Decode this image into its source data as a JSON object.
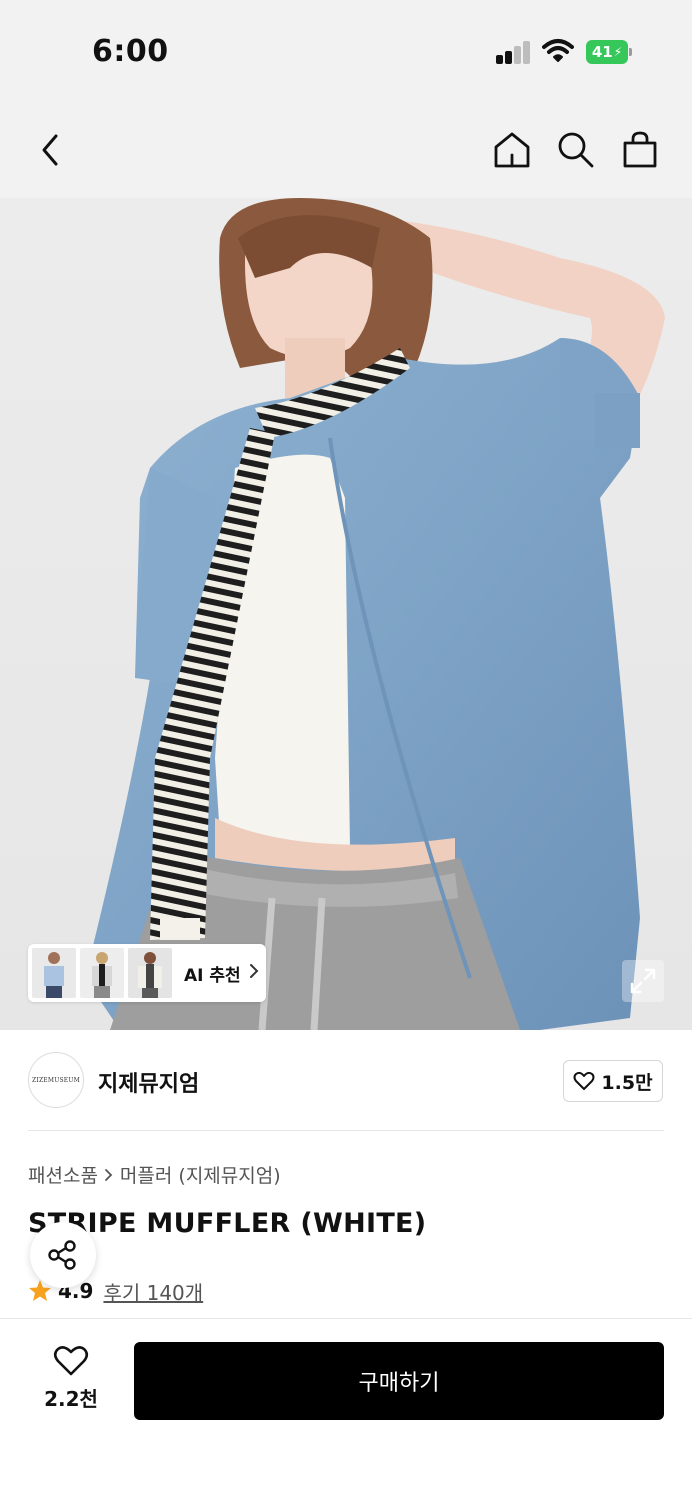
{
  "status_bar": {
    "time": "6:00",
    "battery": "41",
    "icons": [
      "signal-icon",
      "wifi-icon",
      "battery-charging-icon"
    ]
  },
  "top_nav": {
    "icons": [
      "back-icon",
      "home-icon",
      "search-icon",
      "shopping-bag-icon"
    ]
  },
  "hero": {
    "ai_recommend_label": "AI 추천",
    "icons": [
      "chevron-right-icon",
      "expand-icon"
    ]
  },
  "brand": {
    "logo_text": "ZIZEMUSEUM",
    "name": "지제뮤지엄",
    "like_count": "1.5만"
  },
  "breadcrumb": {
    "category": "패션소품",
    "subcategory": "머플러 (지제뮤지엄)"
  },
  "product": {
    "title": "STRIPE MUFFLER (WHITE)",
    "rating": "4.9",
    "reviews": "후기 140개"
  },
  "bottom_bar": {
    "wish_count": "2.2천",
    "buy_label": "구매하기"
  },
  "colors": {
    "header_bg": "#f2f2f2",
    "battery": "#35c759",
    "star": "#f6a21e",
    "buy_button": "#000000",
    "buy_text": "#ffffff"
  }
}
